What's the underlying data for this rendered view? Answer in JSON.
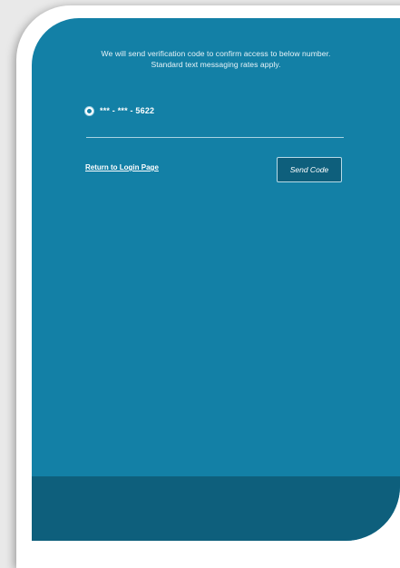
{
  "verification": {
    "message_line1": "We will send verification code to confirm access to below number.",
    "message_line2": "Standard text messaging rates apply.",
    "phone_option": {
      "label": "*** - *** - 5622",
      "selected": true
    },
    "return_link": "Return to Login Page",
    "send_button": "Send Code"
  },
  "colors": {
    "panel": "#1380a6",
    "footer": "#0e5f7c",
    "button": "#0e5f7c"
  }
}
